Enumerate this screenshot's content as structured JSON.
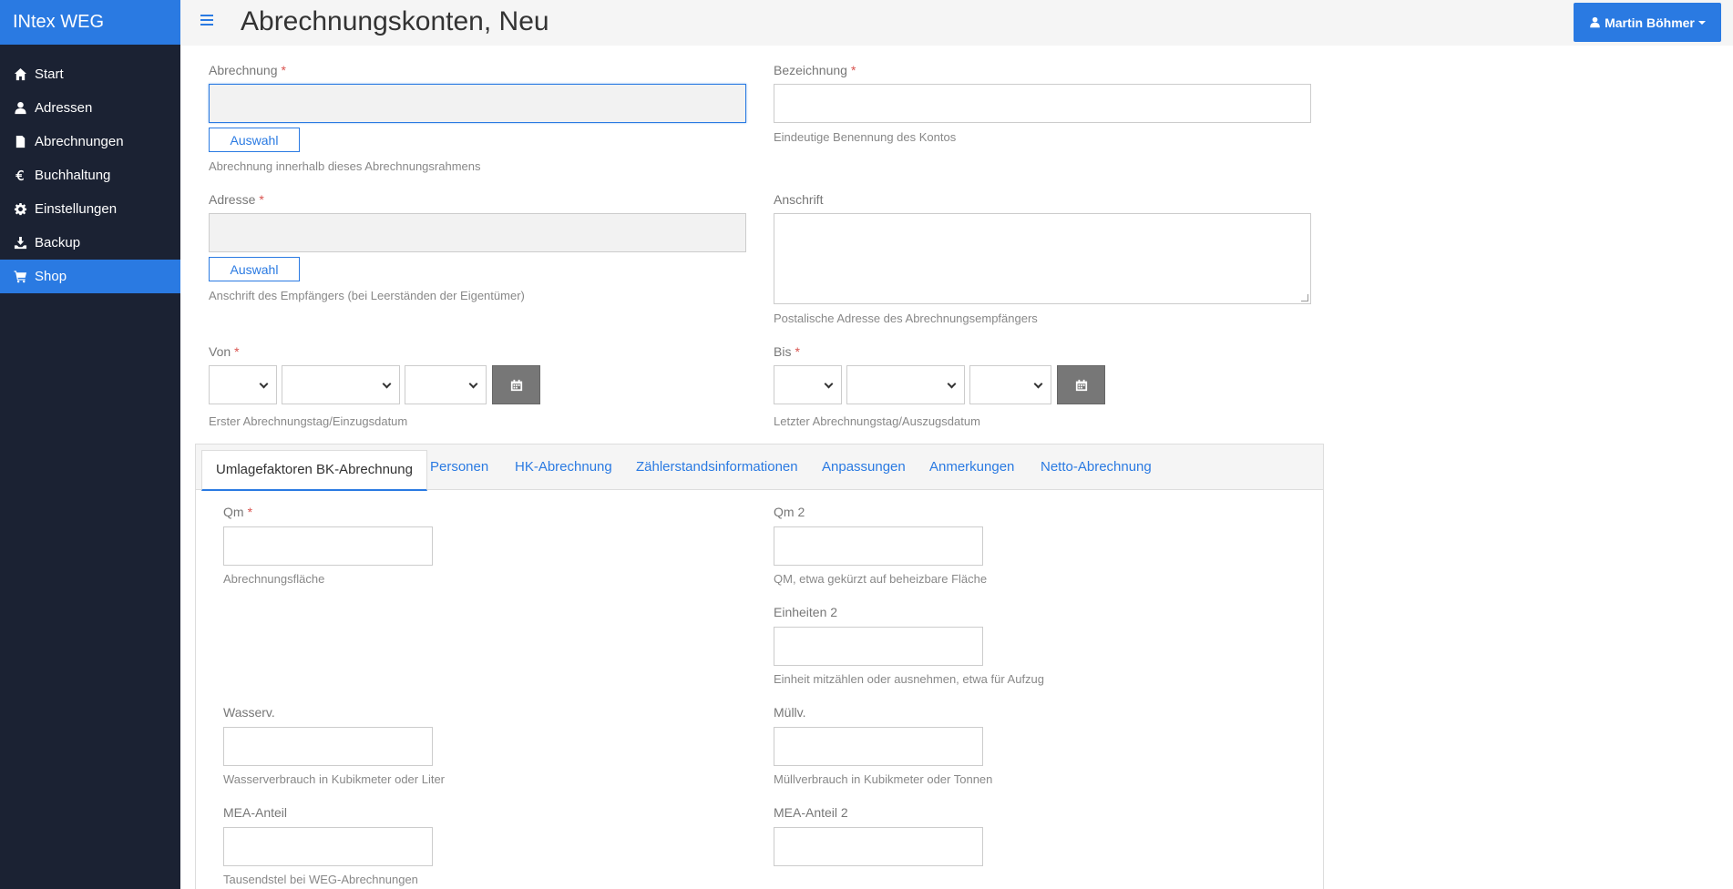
{
  "app": {
    "brand": "INtex WEG"
  },
  "sidebar": {
    "items": [
      {
        "label": "Start",
        "icon": "home-icon"
      },
      {
        "label": "Adressen",
        "icon": "user-icon"
      },
      {
        "label": "Abrechnungen",
        "icon": "file-icon"
      },
      {
        "label": "Buchhaltung",
        "icon": "euro-icon"
      },
      {
        "label": "Einstellungen",
        "icon": "gear-icon"
      },
      {
        "label": "Backup",
        "icon": "download-icon"
      },
      {
        "label": "Shop",
        "icon": "cart-icon",
        "active": true
      }
    ]
  },
  "header": {
    "title": "Abrechnungskonten, Neu",
    "user": "Martin Böhmer"
  },
  "form": {
    "abrechnung": {
      "label": "Abrechnung",
      "required": "*",
      "value": "",
      "button": "Auswahl",
      "help": "Abrechnung innerhalb dieses Abrechnungsrahmens"
    },
    "bezeichnung": {
      "label": "Bezeichnung",
      "required": "*",
      "value": "",
      "help": "Eindeutige Benennung des Kontos"
    },
    "adresse": {
      "label": "Adresse",
      "required": "*",
      "value": "",
      "button": "Auswahl",
      "help": "Anschrift des Empfängers (bei Leerständen der Eigentümer)"
    },
    "anschrift": {
      "label": "Anschrift",
      "value": "",
      "help": "Postalische Adresse des Abrechnungsempfängers"
    },
    "von": {
      "label": "Von",
      "required": "*",
      "help": "Erster Abrechnungstag/Einzugsdatum"
    },
    "bis": {
      "label": "Bis",
      "required": "*",
      "help": "Letzter Abrechnungstag/Auszugsdatum"
    }
  },
  "tabs": [
    {
      "label": "Umlagefaktoren BK-Abrechnung",
      "active": true
    },
    {
      "label": "Personen"
    },
    {
      "label": "HK-Abrechnung"
    },
    {
      "label": "Zählerstandsinformationen"
    },
    {
      "label": "Anpassungen"
    },
    {
      "label": "Anmerkungen"
    },
    {
      "label": "Netto-Abrechnung"
    }
  ],
  "tab_fields": {
    "qm": {
      "label": "Qm",
      "required": "*",
      "value": "",
      "help": "Abrechnungsfläche"
    },
    "qm2": {
      "label": "Qm 2",
      "value": "",
      "help": "QM, etwa gekürzt auf beheizbare Fläche"
    },
    "einheiten2": {
      "label": "Einheiten 2",
      "value": "",
      "help": "Einheit mitzählen oder ausnehmen, etwa für Aufzug"
    },
    "wasserv": {
      "label": "Wasserv.",
      "value": "",
      "help": "Wasserverbrauch in Kubikmeter oder Liter"
    },
    "muellv": {
      "label": "Müllv.",
      "value": "",
      "help": "Müllverbrauch in Kubikmeter oder Tonnen"
    },
    "mea": {
      "label": "MEA-Anteil",
      "value": "",
      "help": "Tausendstel bei WEG-Abrechnungen"
    },
    "mea2": {
      "label": "MEA-Anteil 2",
      "value": ""
    }
  },
  "colors": {
    "accent": "#2a7ae2",
    "sidebar": "#1b2233",
    "required": "#d9534f"
  }
}
